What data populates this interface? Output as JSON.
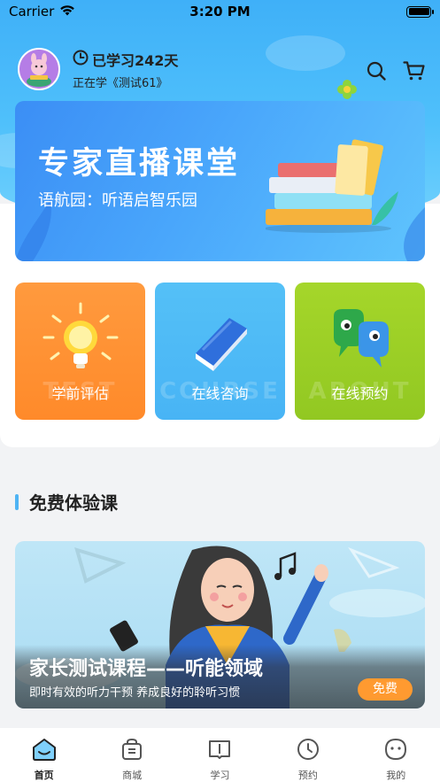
{
  "status_bar": {
    "carrier": "Carrier",
    "time": "3:20 PM"
  },
  "user": {
    "study_days": "已学习242天",
    "current_course": "正在学《测试61》"
  },
  "banner": {
    "title": "专家直播课堂",
    "subtitle": "语航园：听语启智乐园"
  },
  "tiles": [
    {
      "label": "学前评估",
      "bg_word": "TEST",
      "color": "#ff8f33",
      "icon": "lightbulb-icon"
    },
    {
      "label": "在线咨询",
      "bg_word": "COURSE",
      "color": "#50bbf6",
      "icon": "book-icon"
    },
    {
      "label": "在线预约",
      "bg_word": "ABOUT",
      "color": "#9bcf26",
      "icon": "chat-bubbles-icon"
    }
  ],
  "section": {
    "title": "免费体验课"
  },
  "course": {
    "title": "家长测试课程——听能领域",
    "subtitle": "即时有效的听力干预  养成良好的聆听习惯",
    "button": "免费"
  },
  "tabbar": {
    "items": [
      {
        "label": "首页",
        "icon": "home-icon",
        "active": true
      },
      {
        "label": "商城",
        "icon": "shopping-bag-icon",
        "active": false
      },
      {
        "label": "学习",
        "icon": "open-book-icon",
        "active": false
      },
      {
        "label": "预约",
        "icon": "clock-icon",
        "active": false
      },
      {
        "label": "我的",
        "icon": "profile-face-icon",
        "active": false
      }
    ]
  },
  "colors": {
    "accent_blue": "#4fb4f4",
    "accent_orange": "#ff9a30"
  }
}
